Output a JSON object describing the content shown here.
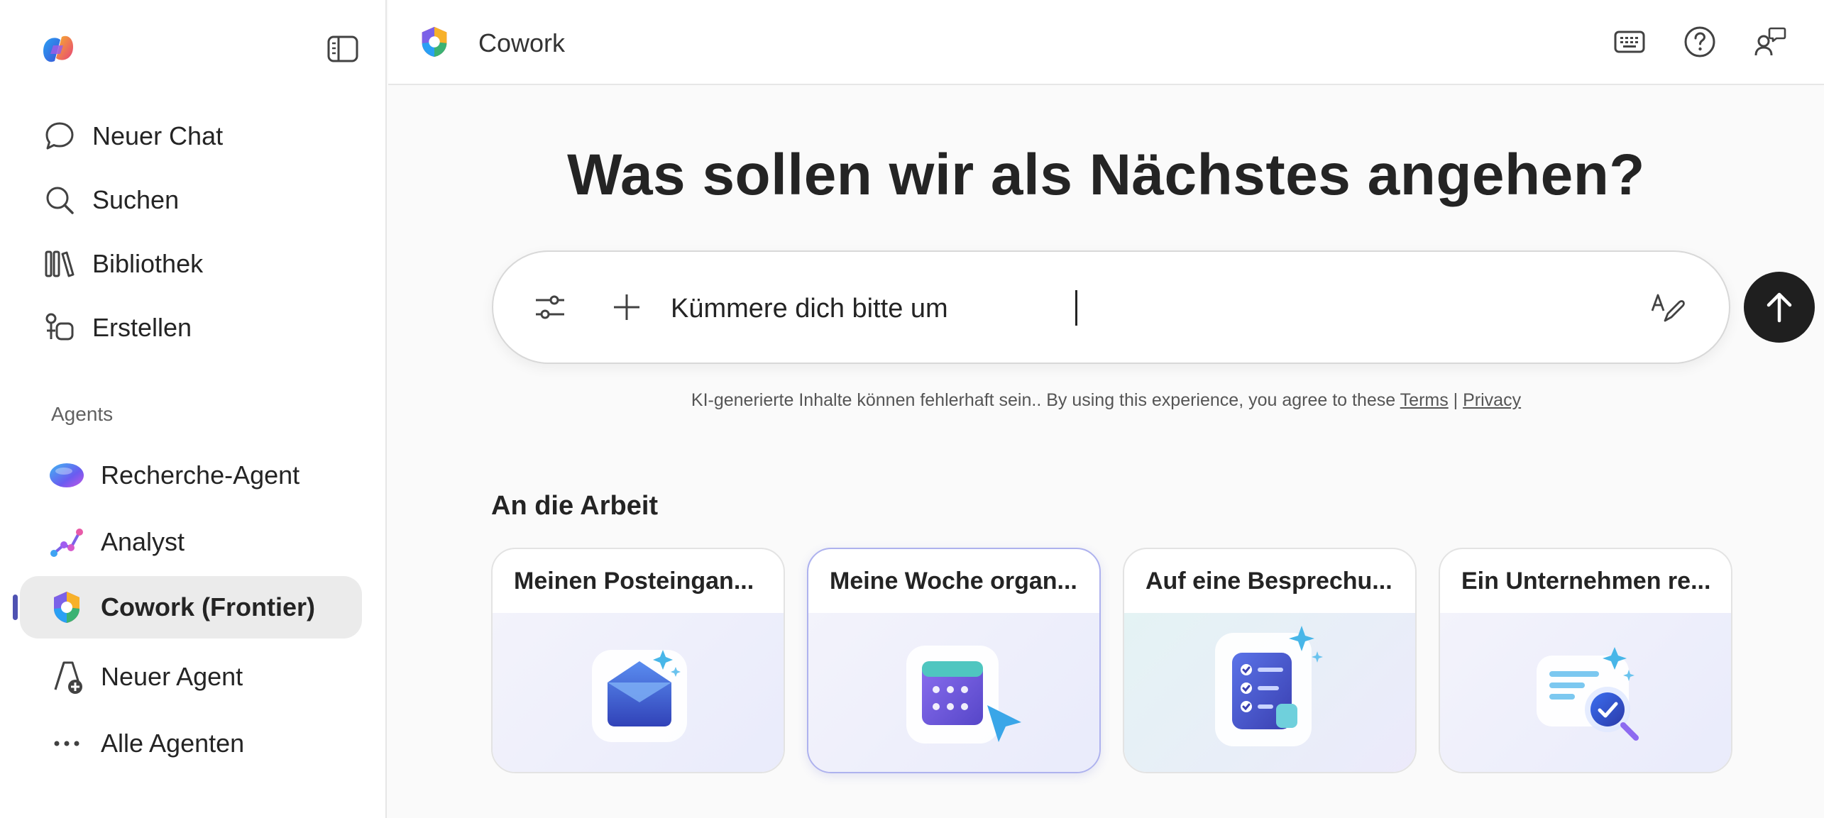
{
  "sidebar": {
    "logo_icon": "copilot-logo-icon",
    "toggle_icon": "sidebar-toggle-icon",
    "nav": [
      {
        "label": "Neuer Chat",
        "icon": "chat-bubble-icon"
      },
      {
        "label": "Suchen",
        "icon": "search-icon"
      },
      {
        "label": "Bibliothek",
        "icon": "library-icon"
      },
      {
        "label": "Erstellen",
        "icon": "create-icon"
      }
    ],
    "agents_heading": "Agents",
    "agents": [
      {
        "label": "Recherche-Agent",
        "icon": "researcher-agent-icon"
      },
      {
        "label": "Analyst",
        "icon": "analyst-agent-icon"
      },
      {
        "label": "Cowork (Frontier)",
        "icon": "cowork-agent-icon",
        "active": true
      },
      {
        "label": "Neuer Agent",
        "icon": "new-agent-icon"
      },
      {
        "label": "Alle Agenten",
        "icon": "more-dots-icon"
      }
    ]
  },
  "header": {
    "title": "Cowork",
    "buttons": [
      "keyboard-icon",
      "help-icon",
      "feedback-icon"
    ]
  },
  "main": {
    "headline": "Was sollen wir als Nächstes angehen?",
    "composer": {
      "value": "Kümmere dich bitte um",
      "send_icon": "arrow-up-icon"
    },
    "disclaimer": {
      "text": "KI-generierte Inhalte können fehlerhaft sein.. By using this experience, you agree to these ",
      "terms": "Terms",
      "sep": " | ",
      "privacy": "Privacy"
    },
    "section_title": "An die Arbeit",
    "cards": [
      {
        "title": "Meinen Posteingan...",
        "icon": "mail-envelope-icon"
      },
      {
        "title": "Meine Woche organ...",
        "icon": "calendar-cursor-icon"
      },
      {
        "title": "Auf eine Besprechu...",
        "icon": "checklist-icon"
      },
      {
        "title": "Ein Unternehmen re...",
        "icon": "research-magnifier-icon"
      }
    ]
  },
  "colors": {
    "accent": "#4f52b2",
    "send_button": "#1f1f1f",
    "active_item_bg": "#ebebeb"
  }
}
